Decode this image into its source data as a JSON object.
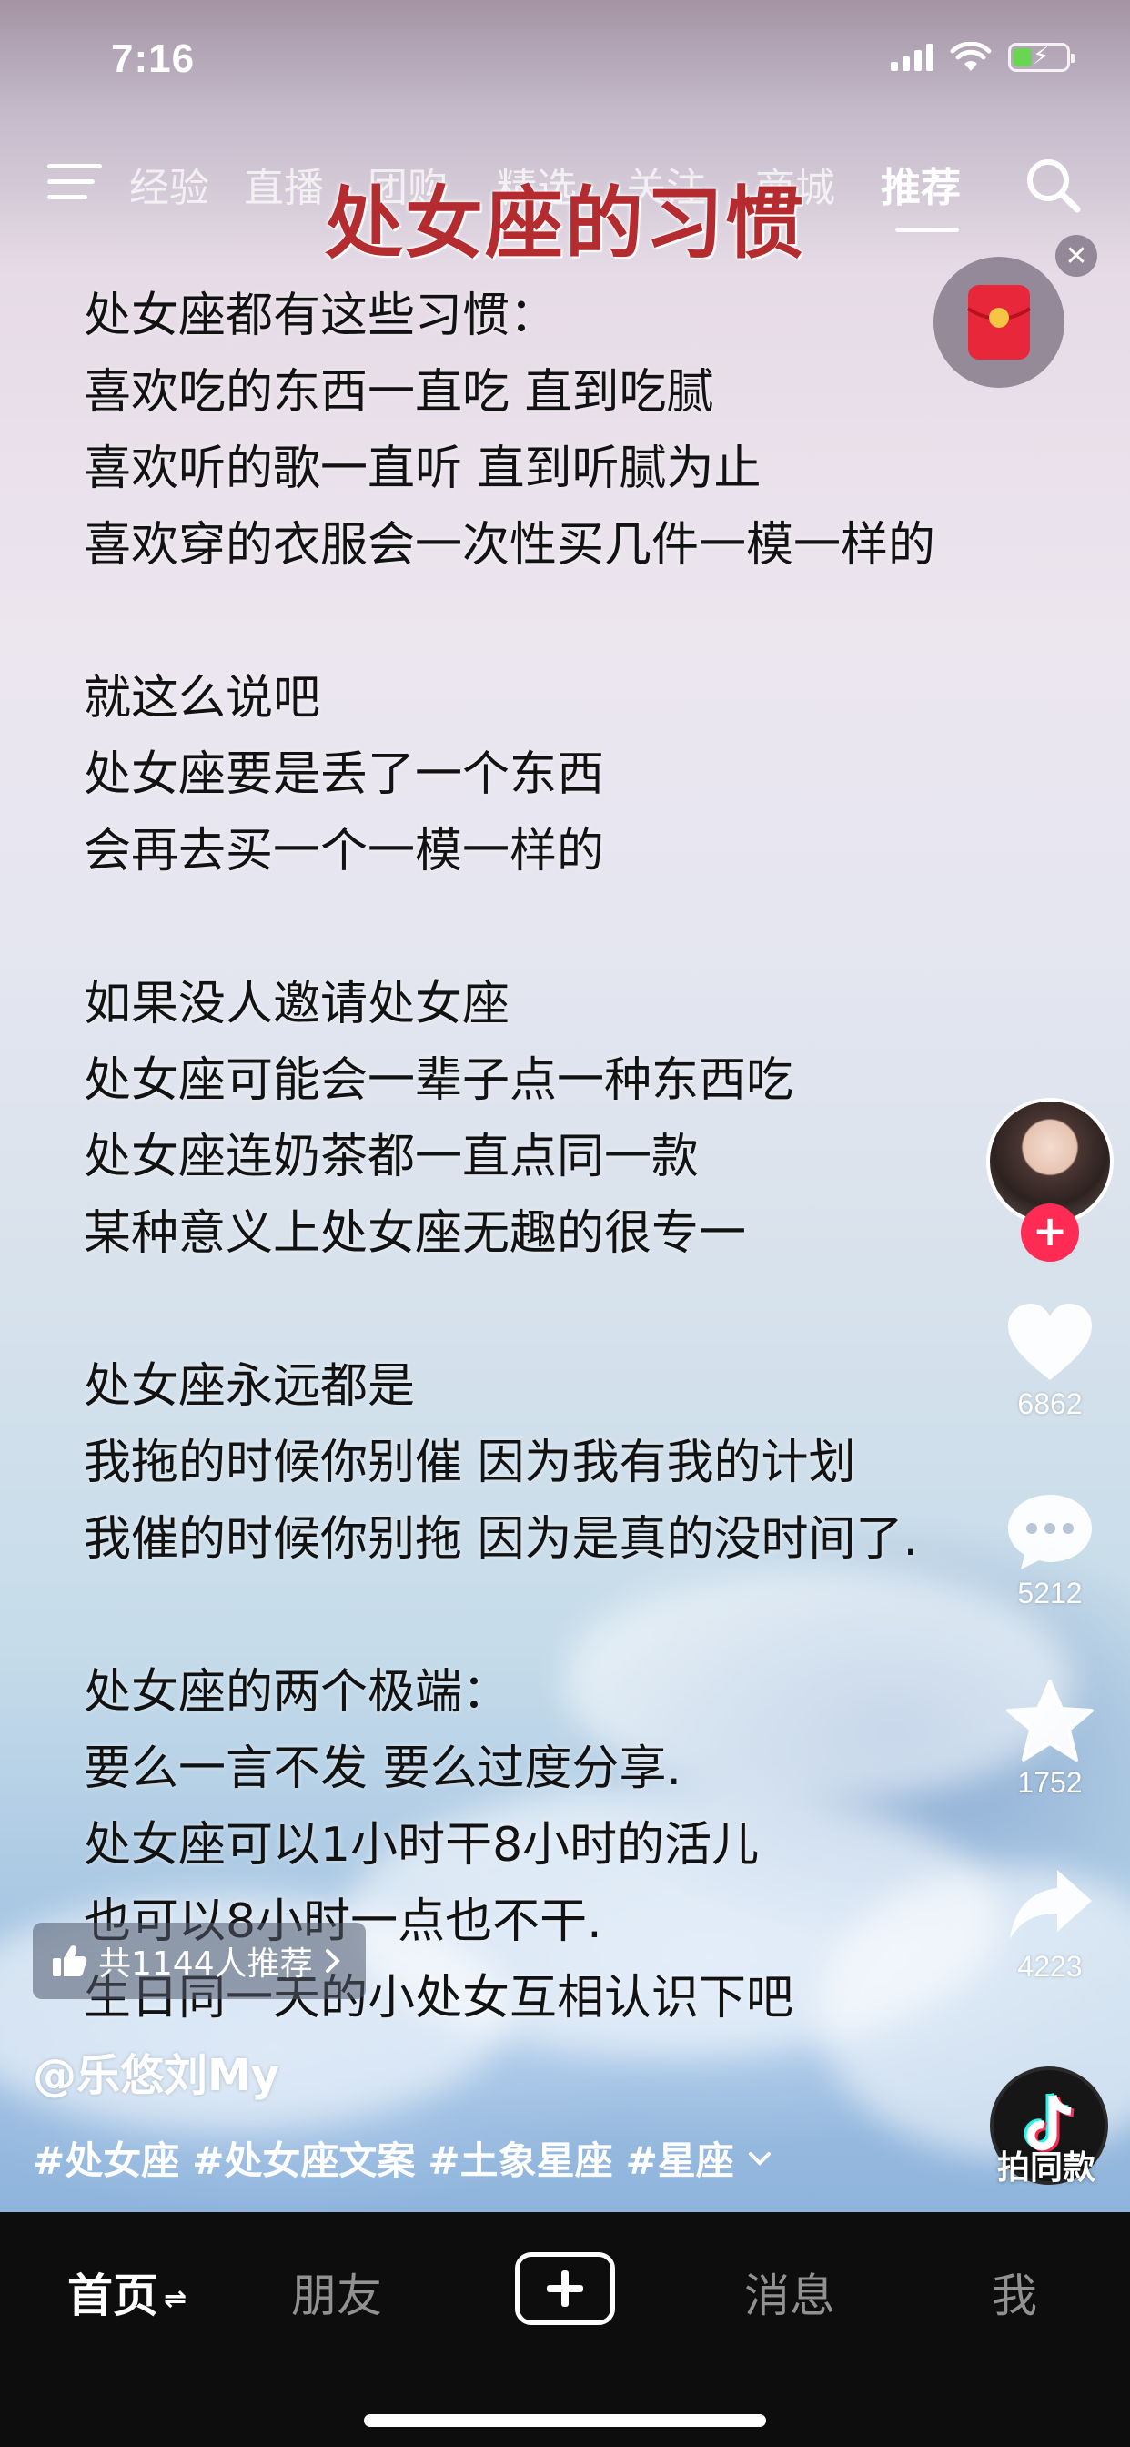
{
  "status_bar": {
    "time": "7:16"
  },
  "top_nav": {
    "tabs": [
      {
        "label": "经验"
      },
      {
        "label": "直播"
      },
      {
        "label": "团购"
      },
      {
        "label": "精选"
      },
      {
        "label": "关注"
      },
      {
        "label": "商城"
      },
      {
        "label": "推荐",
        "active": true
      }
    ]
  },
  "video": {
    "headline": "处女座的习惯",
    "lines": [
      "处女座都有这些习惯：",
      "喜欢吃的东西一直吃 直到吃腻",
      "喜欢听的歌一直听 直到听腻为止",
      "喜欢穿的衣服会一次性买几件一模一样的",
      "",
      "就这么说吧",
      "处女座要是丢了一个东西",
      "会再去买一个一模一样的",
      "",
      "如果没人邀请处女座",
      "处女座可能会一辈子点一种东西吃",
      "处女座连奶茶都一直点同一款",
      "某种意义上处女座无趣的很专一",
      "",
      "处女座永远都是",
      "我拖的时候你别催 因为我有我的计划",
      "我催的时候你别拖 因为是真的没时间了.",
      "",
      "处女座的两个极端：",
      "要么一言不发 要么过度分享.",
      "处女座可以1小时干8小时的活儿",
      "也可以8小时一点也不干.",
      "生日同一天的小处女互相认识下吧"
    ]
  },
  "actions": {
    "likes": "6862",
    "comments": "5212",
    "favorites": "1752",
    "shares": "4223"
  },
  "info": {
    "recommend": "共1144人推荐",
    "author": "@乐悠刘My",
    "hashtags": [
      "#处女座",
      "#处女座文案",
      "#土象星座",
      "#星座"
    ],
    "music_label": "拍同款"
  },
  "bottom_nav": {
    "home": "首页",
    "friends": "朋友",
    "messages": "消息",
    "me": "我"
  },
  "colors": {
    "headline": "#b42c2f",
    "follow": "#fe2c55",
    "battery": "#6ad553"
  }
}
